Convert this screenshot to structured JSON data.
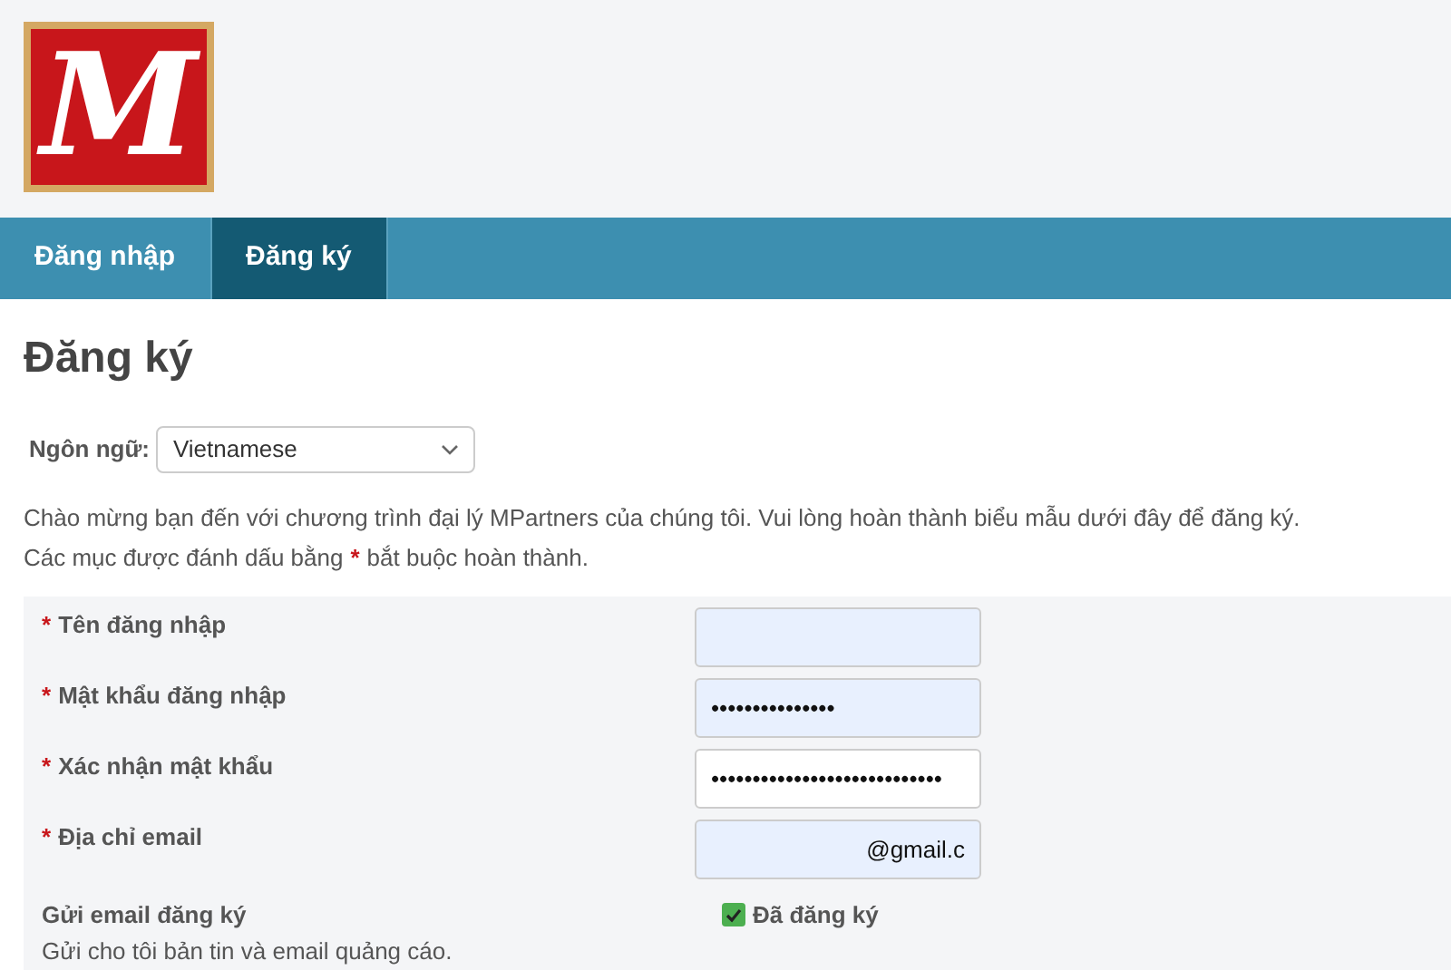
{
  "logo": {
    "letter": "M"
  },
  "tabs": [
    {
      "label": "Đăng nhập",
      "selected": false
    },
    {
      "label": "Đăng ký",
      "selected": true
    }
  ],
  "heading": "Đăng ký",
  "language": {
    "label": "Ngôn ngữ:",
    "value": "Vietnamese"
  },
  "intro": "Chào mừng bạn đến với chương trình đại lý MPartners của chúng tôi. Vui lòng hoàn thành biểu mẫu dưới đây để đăng ký.",
  "legend": {
    "before": "Các mục được đánh dấu bằng",
    "mark": "*",
    "after": "bắt buộc hoàn thành."
  },
  "fields": [
    {
      "kind": "input",
      "required_mark": "*",
      "label": "Tên đăng nhập",
      "autofilled": true,
      "scrolled_to_end": false
    },
    {
      "kind": "input",
      "required_mark": "*",
      "label": "Mật khẩu đăng nhập",
      "autofilled": true,
      "value": "•••••••••••••••",
      "scrolled_to_end": false
    },
    {
      "kind": "input",
      "required_mark": "*",
      "label": "Xác nhận mật khẩu",
      "autofilled": false,
      "value": "••••••••••••••••••••••••••••",
      "scrolled_to_end": false
    },
    {
      "kind": "input",
      "required_mark": "*",
      "label": "Địa chỉ email",
      "autofilled": true,
      "value": "@gmail.c",
      "scrolled_to_end": true
    },
    {
      "kind": "checkbox",
      "label": "Gửi email đăng ký",
      "hint": "Gửi cho tôi bản tin và email quảng cáo.",
      "checked": true,
      "option": "Đã đăng ký"
    }
  ]
}
